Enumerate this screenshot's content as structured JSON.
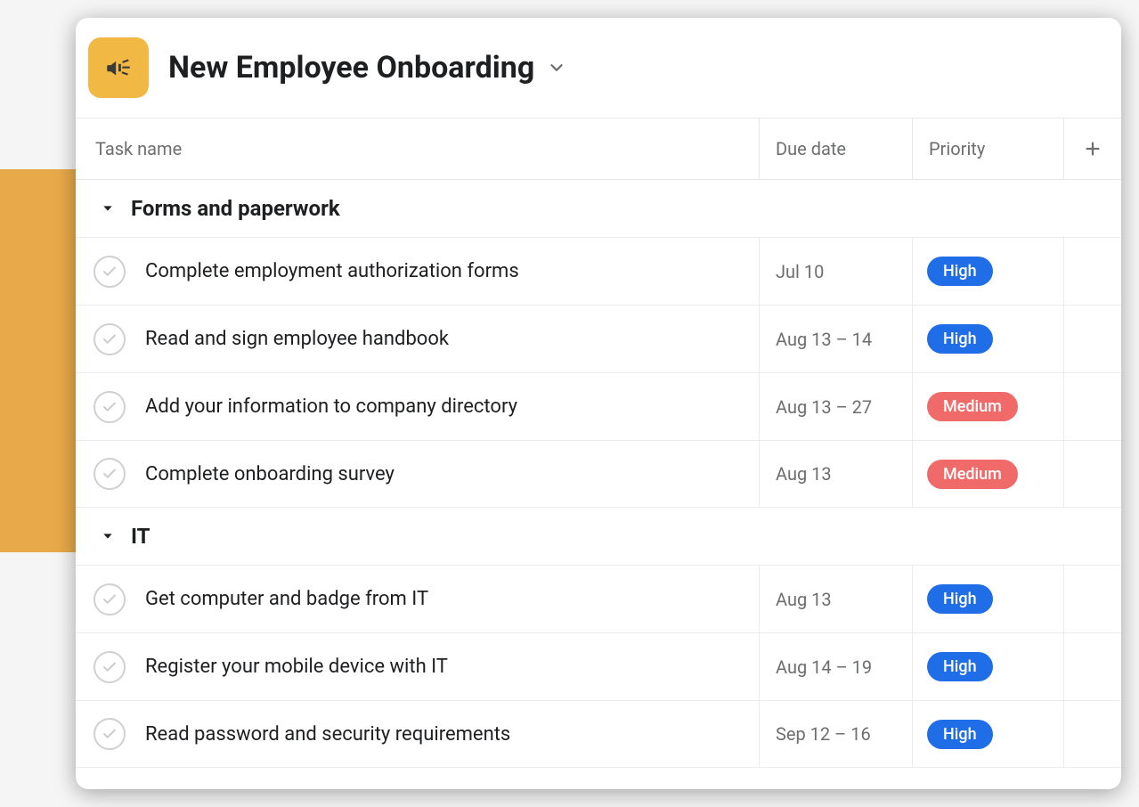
{
  "project": {
    "title": "New Employee Onboarding",
    "icon": "megaphone"
  },
  "columns": {
    "task": "Task name",
    "due": "Due date",
    "priority": "Priority"
  },
  "priority_styles": {
    "High": "pill-high",
    "Medium": "pill-medium"
  },
  "sections": [
    {
      "name": "Forms and paperwork",
      "tasks": [
        {
          "name": "Complete employment authorization forms",
          "due": "Jul 10",
          "priority": "High"
        },
        {
          "name": "Read and sign employee handbook",
          "due": "Aug 13 – 14",
          "priority": "High"
        },
        {
          "name": "Add your information to company directory",
          "due": "Aug 13 – 27",
          "priority": "Medium"
        },
        {
          "name": "Complete onboarding survey",
          "due": "Aug 13",
          "priority": "Medium"
        }
      ]
    },
    {
      "name": "IT",
      "tasks": [
        {
          "name": "Get computer and badge from IT",
          "due": "Aug 13",
          "priority": "High"
        },
        {
          "name": "Register your mobile device with IT",
          "due": "Aug 14 – 19",
          "priority": "High"
        },
        {
          "name": "Read password and security requirements",
          "due": "Sep 12 – 16",
          "priority": "High"
        }
      ]
    }
  ]
}
